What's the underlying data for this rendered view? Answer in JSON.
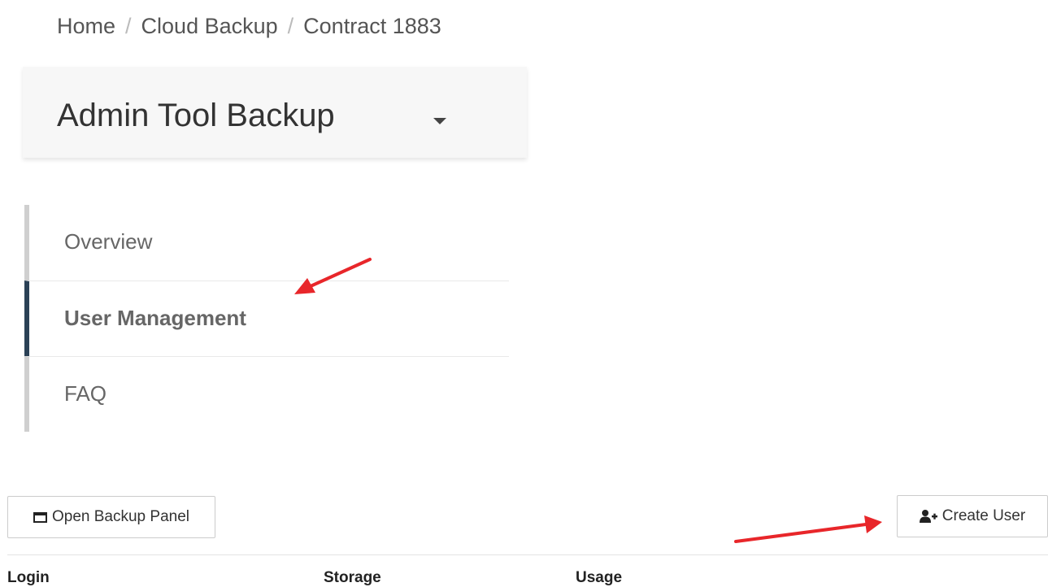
{
  "breadcrumb": {
    "items": [
      "Home",
      "Cloud Backup",
      "Contract 1883"
    ],
    "separator": "/"
  },
  "header": {
    "title": "Admin Tool Backup"
  },
  "nav": {
    "items": [
      {
        "label": "Overview",
        "active": false
      },
      {
        "label": "User Management",
        "active": true
      },
      {
        "label": "FAQ",
        "active": false
      }
    ]
  },
  "toolbar": {
    "open_backup_panel_label": "Open Backup Panel",
    "create_user_label": "Create User"
  },
  "table": {
    "columns": [
      "Login",
      "Storage",
      "Usage"
    ]
  },
  "colors": {
    "active_indicator": "#2b4156",
    "inactive_indicator": "#cfcfcf",
    "annotation_arrow": "#e8262a"
  },
  "icons": {
    "open_backup_panel": "window-icon",
    "create_user": "user-plus-icon",
    "title_dropdown": "caret-down-icon"
  }
}
